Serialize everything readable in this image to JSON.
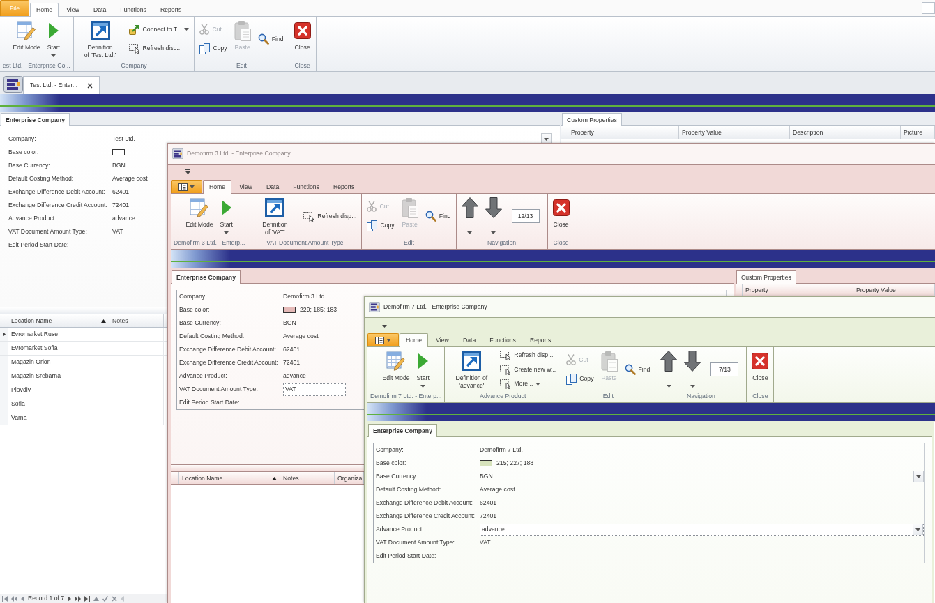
{
  "main_window": {
    "app_menu": {
      "label": "File"
    },
    "tabs": [
      {
        "label": "Home",
        "selected": true
      },
      {
        "label": "View",
        "selected": false
      },
      {
        "label": "Data",
        "selected": false
      },
      {
        "label": "Functions",
        "selected": false
      },
      {
        "label": "Reports",
        "selected": false
      }
    ],
    "ribbon_groups": [
      {
        "caption": "est Ltd. - Enterprise Co...",
        "items": [
          {
            "kind": "edit",
            "label": "Edit Mode",
            "disabled": false,
            "dropdown": false
          },
          {
            "kind": "start",
            "label": "Start",
            "disabled": false,
            "dropdown": true
          }
        ]
      },
      {
        "caption": "Company",
        "items": [
          {
            "kind": "definition",
            "label": "Definition of 'Test Ltd.'",
            "disabled": false,
            "dropdown": false
          },
          {
            "kind": "connect",
            "label": "Connect to T...",
            "disabled": false,
            "dropdown": true
          },
          {
            "kind": "refresh",
            "label": "Refresh disp...",
            "disabled": false,
            "dropdown": false
          }
        ]
      },
      {
        "caption": "Edit",
        "items": [
          {
            "kind": "cut",
            "label": "Cut",
            "disabled": true,
            "dropdown": false
          },
          {
            "kind": "copy",
            "label": "Copy",
            "disabled": false,
            "dropdown": false
          },
          {
            "kind": "paste",
            "label": "Paste",
            "disabled": true,
            "dropdown": false
          },
          {
            "kind": "find",
            "label": "Find",
            "disabled": false,
            "dropdown": false
          }
        ]
      },
      {
        "caption": "Close",
        "items": [
          {
            "kind": "close",
            "label": "Close",
            "disabled": false,
            "dropdown": false
          }
        ]
      }
    ],
    "document_tabs": [
      {
        "label": "Test Ltd. - Enter...",
        "selected": true
      }
    ],
    "details": {
      "tab": "Enterprise Company",
      "fields": [
        {
          "kind": "text",
          "label": "Company:",
          "value": "Test Ltd.",
          "selected": false,
          "dropdown": true
        },
        {
          "kind": "color",
          "label": "Base color:",
          "color": "#ffffff",
          "selected": false,
          "dropdown": false
        },
        {
          "kind": "text",
          "label": "Base Currency:",
          "value": "BGN",
          "selected": false,
          "dropdown": false
        },
        {
          "kind": "text",
          "label": "Default Costing Method:",
          "value": "Average cost",
          "selected": false,
          "dropdown": false
        },
        {
          "kind": "text",
          "label": "Exchange Difference Debit Account:",
          "value": "62401",
          "selected": false,
          "dropdown": false
        },
        {
          "kind": "text",
          "label": "Exchange Difference Credit Account:",
          "value": "72401",
          "selected": false,
          "dropdown": false
        },
        {
          "kind": "text",
          "label": "Advance Product:",
          "value": "advance",
          "selected": false,
          "dropdown": false
        },
        {
          "kind": "text",
          "label": "VAT Document Amount Type:",
          "value": "VAT",
          "selected": false,
          "dropdown": false
        },
        {
          "kind": "text",
          "label": "Edit Period Start Date:",
          "selected": false,
          "dropdown": false
        }
      ]
    },
    "custom_properties": {
      "tab": "Custom Properties",
      "columns": [
        "Property",
        "Property Value",
        "Description",
        "Picture"
      ]
    },
    "locations": {
      "columns": [
        {
          "label": "Location Name",
          "sorted": true
        },
        {
          "label": "Notes",
          "sorted": false
        }
      ],
      "rows": [
        {
          "location_name": "Evromarket Ruse",
          "selected": true
        },
        {
          "location_name": "Evromarket Sofia",
          "selected": false
        },
        {
          "location_name": "Magazin Orion",
          "selected": false
        },
        {
          "location_name": "Magazin Srebarna",
          "selected": false
        },
        {
          "location_name": "Plovdiv",
          "selected": false
        },
        {
          "location_name": "Sofia",
          "selected": false
        },
        {
          "location_name": "Varna",
          "selected": false
        }
      ]
    },
    "navigator": {
      "record": "Record 1 of 7"
    }
  },
  "windows": [
    {
      "title": "Demofirm 3 Ltd. - Enterprise Company",
      "active": false,
      "tabs": [
        {
          "label": "Home",
          "selected": true
        },
        {
          "label": "View",
          "selected": false
        },
        {
          "label": "Data",
          "selected": false
        },
        {
          "label": "Functions",
          "selected": false
        },
        {
          "label": "Reports",
          "selected": false
        }
      ],
      "ribbon_groups": [
        {
          "caption": "Demofirm 3 Ltd. - Enterp...",
          "items": [
            {
              "kind": "edit",
              "label": "Edit Mode",
              "disabled": false,
              "dropdown": false
            },
            {
              "kind": "start",
              "label": "Start",
              "disabled": false,
              "dropdown": true
            }
          ]
        },
        {
          "caption": "VAT Document Amount Type",
          "items": [
            {
              "kind": "definition",
              "label": "Definition of 'VAT'",
              "disabled": false,
              "dropdown": false
            },
            {
              "kind": "refresh",
              "label": "Refresh disp...",
              "disabled": false,
              "dropdown": false
            }
          ]
        },
        {
          "caption": "Edit",
          "items": [
            {
              "kind": "cut",
              "label": "Cut",
              "disabled": true,
              "dropdown": false
            },
            {
              "kind": "copy",
              "label": "Copy",
              "disabled": false,
              "dropdown": false
            },
            {
              "kind": "paste",
              "label": "Paste",
              "disabled": true,
              "dropdown": false
            },
            {
              "kind": "find",
              "label": "Find",
              "disabled": false,
              "dropdown": false
            }
          ]
        },
        {
          "caption": "Navigation",
          "items": [
            {
              "kind": "previous",
              "disabled": false,
              "dropdown": true
            },
            {
              "kind": "next",
              "disabled": false,
              "dropdown": true
            },
            {
              "kind": "position",
              "value": "12/13",
              "disabled": false,
              "dropdown": false
            }
          ]
        },
        {
          "caption": "Close",
          "items": [
            {
              "kind": "close",
              "label": "Close",
              "disabled": false,
              "dropdown": false
            }
          ]
        }
      ],
      "details": {
        "tab": "Enterprise Company",
        "fields": [
          {
            "kind": "text",
            "label": "Company:",
            "value": "Demofirm 3 Ltd.",
            "selected": false,
            "dropdown": false
          },
          {
            "kind": "color",
            "label": "Base color:",
            "color": "#e5b9b7",
            "value": "229; 185; 183",
            "selected": false,
            "dropdown": false
          },
          {
            "kind": "text",
            "label": "Base Currency:",
            "value": "BGN",
            "selected": false,
            "dropdown": false
          },
          {
            "kind": "text",
            "label": "Default Costing Method:",
            "value": "Average cost",
            "selected": false,
            "dropdown": false
          },
          {
            "kind": "text",
            "label": "Exchange Difference Debit Account:",
            "value": "62401",
            "selected": false,
            "dropdown": false
          },
          {
            "kind": "text",
            "label": "Exchange Difference Credit Account:",
            "value": "72401",
            "selected": false,
            "dropdown": false
          },
          {
            "kind": "text",
            "label": "Advance Product:",
            "value": "advance",
            "selected": false,
            "dropdown": false
          },
          {
            "kind": "text",
            "label": "VAT Document Amount Type:",
            "value": "VAT",
            "selected": true,
            "dropdown": false
          },
          {
            "kind": "text",
            "label": "Edit Period Start Date:",
            "selected": false,
            "dropdown": false
          }
        ]
      },
      "custom_properties": {
        "tab": "Custom Properties",
        "columns": [
          "Property",
          "Property Value"
        ]
      },
      "locations": {
        "columns": [
          {
            "label": "Location Name",
            "sorted": true
          },
          {
            "label": "Notes",
            "sorted": false
          },
          {
            "label": "Organiza",
            "sorted": false
          }
        ]
      }
    },
    {
      "title": "Demofirm 7 Ltd. - Enterprise Company",
      "active": true,
      "tabs": [
        {
          "label": "Home",
          "selected": true
        },
        {
          "label": "View",
          "selected": false
        },
        {
          "label": "Data",
          "selected": false
        },
        {
          "label": "Functions",
          "selected": false
        },
        {
          "label": "Reports",
          "selected": false
        }
      ],
      "ribbon_groups": [
        {
          "caption": "Demofirm 7 Ltd. - Enterp...",
          "items": [
            {
              "kind": "edit",
              "label": "Edit Mode",
              "disabled": false,
              "dropdown": false
            },
            {
              "kind": "start",
              "label": "Start",
              "disabled": false,
              "dropdown": true
            }
          ]
        },
        {
          "caption": "Advance Product",
          "items": [
            {
              "kind": "definition",
              "label": "Definition of 'advance'",
              "disabled": false,
              "dropdown": false
            },
            {
              "kind": "refresh",
              "label": "Refresh disp...",
              "disabled": false,
              "dropdown": false
            },
            {
              "kind": "create",
              "label": "Create new w...",
              "disabled": false,
              "dropdown": false
            },
            {
              "kind": "more",
              "label": "More...",
              "disabled": false,
              "dropdown": true
            }
          ]
        },
        {
          "caption": "Edit",
          "items": [
            {
              "kind": "cut",
              "label": "Cut",
              "disabled": true,
              "dropdown": false
            },
            {
              "kind": "copy",
              "label": "Copy",
              "disabled": false,
              "dropdown": false
            },
            {
              "kind": "paste",
              "label": "Paste",
              "disabled": true,
              "dropdown": false
            },
            {
              "kind": "find",
              "label": "Find",
              "disabled": false,
              "dropdown": false
            }
          ]
        },
        {
          "caption": "Navigation",
          "items": [
            {
              "kind": "previous",
              "disabled": false,
              "dropdown": true
            },
            {
              "kind": "next",
              "disabled": false,
              "dropdown": true
            },
            {
              "kind": "position",
              "value": "7/13",
              "disabled": false,
              "dropdown": false
            }
          ]
        },
        {
          "caption": "Close",
          "items": [
            {
              "kind": "close",
              "label": "Close",
              "disabled": false,
              "dropdown": false
            }
          ]
        }
      ],
      "details": {
        "tab": "Enterprise Company",
        "fields": [
          {
            "kind": "text",
            "label": "Company:",
            "value": "Demofirm 7 Ltd.",
            "selected": false,
            "dropdown": false
          },
          {
            "kind": "color",
            "label": "Base color:",
            "color": "#d7e3bc",
            "value": "215; 227; 188",
            "selected": false,
            "dropdown": false
          },
          {
            "kind": "text",
            "label": "Base Currency:",
            "value": "BGN",
            "selected": false,
            "dropdown": true
          },
          {
            "kind": "text",
            "label": "Default Costing Method:",
            "value": "Average cost",
            "selected": false,
            "dropdown": false
          },
          {
            "kind": "text",
            "label": "Exchange Difference Debit Account:",
            "value": "62401",
            "selected": false,
            "dropdown": false
          },
          {
            "kind": "text",
            "label": "Exchange Difference Credit Account:",
            "value": "72401",
            "selected": false,
            "dropdown": false
          },
          {
            "kind": "text",
            "label": "Advance Product:",
            "value": "advance",
            "selected": true,
            "dropdown": true
          },
          {
            "kind": "text",
            "label": "VAT Document Amount Type:",
            "value": "VAT",
            "selected": false,
            "dropdown": false
          },
          {
            "kind": "text",
            "label": "Edit Period Start Date:",
            "selected": false,
            "dropdown": false
          }
        ]
      }
    }
  ]
}
